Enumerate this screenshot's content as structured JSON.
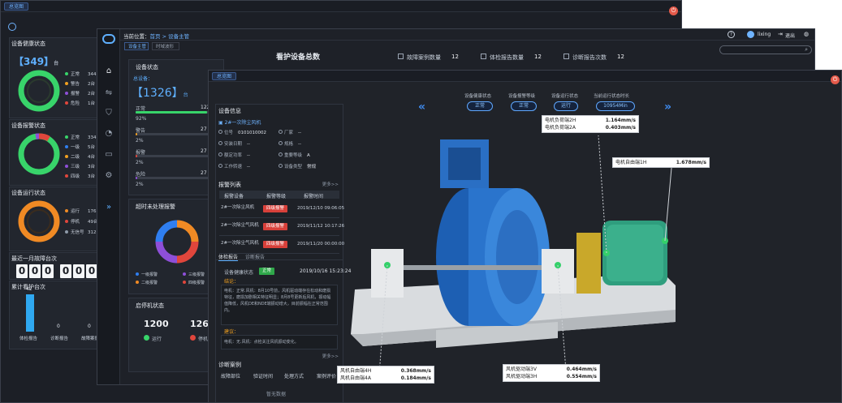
{
  "win1": {
    "tab": "总览图",
    "health_title": "设备健康状态",
    "health_total": "【349】",
    "health_unit": "台",
    "health_legend": [
      {
        "label": "正常",
        "value": "344台",
        "color": "#38d46a"
      },
      {
        "label": "警告",
        "value": "2台",
        "color": "#f0a020"
      },
      {
        "label": "报警",
        "value": "2台",
        "color": "#8e4fd8"
      },
      {
        "label": "危险",
        "value": "1台",
        "color": "#e0463c"
      }
    ],
    "alarm_title": "设备报警状态",
    "alarm_legend": [
      {
        "label": "正常",
        "value": "334台",
        "color": "#38d46a"
      },
      {
        "label": "一级",
        "value": "5台",
        "color": "#2f7ef0"
      },
      {
        "label": "二级",
        "value": "4台",
        "color": "#f0a020"
      },
      {
        "label": "三级",
        "value": "3台",
        "color": "#8e4fd8"
      },
      {
        "label": "四级",
        "value": "3台",
        "color": "#e0463c"
      }
    ],
    "run_title": "设备运行状态",
    "run_legend": [
      {
        "label": "运行",
        "value": "176台",
        "color": "#f08a24"
      },
      {
        "label": "停机",
        "value": "49台",
        "color": "#e0463c"
      },
      {
        "label": "无信号",
        "value": "312台",
        "color": "#8e9aa8"
      }
    ],
    "fault_title": "最近一月故障台次",
    "fault_digits": [
      "0",
      "0",
      "0",
      "0",
      "0",
      "0"
    ],
    "acc_title": "累计看护台次",
    "acc_bars": [
      {
        "label": "体检报告",
        "value": "42",
        "fraction": 1.0
      },
      {
        "label": "诊断报告",
        "value": "0",
        "fraction": 0.0
      },
      {
        "label": "故障案例",
        "value": "0",
        "fraction": 0.0
      }
    ]
  },
  "win2": {
    "breadcrumb_prefix": "当前位置：",
    "breadcrumb": "首页 > 设备主管",
    "tabs": [
      "设备主管",
      "时域波形"
    ],
    "header_title": "看护设备总数",
    "stats": [
      {
        "label": "故障案例数量",
        "value": "12"
      },
      {
        "label": "体检报告数量",
        "value": "12"
      },
      {
        "label": "诊断报告次数",
        "value": "12"
      }
    ],
    "user": "lixing",
    "logout": "退出",
    "status_title": "设备状态",
    "total_label": "总设备：",
    "total_value": "【1326】",
    "total_unit": "台",
    "status_rows": [
      {
        "label": "正常",
        "count": "1220",
        "pct": "92%",
        "color": "#38d46a",
        "fraction": 0.92
      },
      {
        "label": "警告",
        "count": "27",
        "pct": "2%",
        "color": "#f0a020",
        "fraction": 0.02
      },
      {
        "label": "报警",
        "count": "27",
        "pct": "2%",
        "color": "#e0463c",
        "fraction": 0.02
      },
      {
        "label": "危险",
        "count": "27",
        "pct": "2%",
        "color": "#8e4fd8",
        "fraction": 0.02
      }
    ],
    "overdue_title": "超时未处理报警",
    "overdue_legend": [
      "一级报警",
      "三级报警",
      "二级报警",
      "四级报警"
    ],
    "overdue_colors": [
      "#2f7ef0",
      "#8e4fd8",
      "#f08a24",
      "#e0463c"
    ],
    "start_title": "启停机状态",
    "running_value": "1200",
    "running_label": "运行",
    "stop_value": "126",
    "stop_label": "停机"
  },
  "win3": {
    "tab": "总览图",
    "info_title": "设备信息",
    "device_name": "2#一次除尘风机",
    "fields": [
      {
        "label": "位号",
        "value": "0101010002"
      },
      {
        "label": "厂家",
        "value": "--"
      },
      {
        "label": "安装日期",
        "value": "--"
      },
      {
        "label": "规格",
        "value": "--"
      },
      {
        "label": "额定功率",
        "value": "--"
      },
      {
        "label": "重要等级",
        "value": "A"
      },
      {
        "label": "工作转速",
        "value": "--"
      },
      {
        "label": "设备类型",
        "value": "常规"
      }
    ],
    "more": "更多>>",
    "alarm_list_title": "报警列表",
    "alarm_cols": [
      "报警设备",
      "报警等级",
      "报警时间"
    ],
    "alarms": [
      {
        "device": "2#一次除尘风机",
        "level": "四级报警",
        "time": "2019/12/10 09:06:05"
      },
      {
        "device": "2#一次除尘气风机",
        "level": "四级报警",
        "time": "2019/11/12 10:17:26"
      },
      {
        "device": "2#一次除尘气风机",
        "level": "四级报警",
        "time": "2019/11/20 00:00:00"
      }
    ],
    "report_tabs": [
      "体检报告",
      "诊断报告"
    ],
    "health_label": "设备健康状态",
    "health_badge": "正常",
    "report_time": "2019/10/16 15:23:24",
    "conclusion_label": "结论：",
    "conclusion_text": "电机：正常.风机：8月10号前，风机驱动端存在松动和磨损特征，磨损加剧相关特征明显；8月8号更新后风机，振动幅值降低，风机DE和NDE端振动增大，目前振幅在正常范围内。",
    "suggest_label": "建议：",
    "suggest_text": "电机：无.风机：点检关注风机振动变化。",
    "case_title": "诊断案例",
    "case_cols": [
      "故障部位",
      "验证时间",
      "处理方式",
      "案例评价"
    ],
    "empty": "暂无数据",
    "nav_labels": [
      "设备健康状态",
      "设备报警等级",
      "设备运行状态",
      "当前运行状态时长"
    ],
    "nav_values": [
      "正常",
      "正常",
      "运行",
      "10954Min"
    ],
    "callouts": [
      {
        "rows": [
          [
            "电机负荷端2H",
            "1.164mm/s"
          ],
          [
            "电机负荷端2A",
            "0.403mm/s"
          ]
        ]
      },
      {
        "rows": [
          [
            "电机自由端1H",
            "1.678mm/s"
          ]
        ]
      },
      {
        "rows": [
          [
            "风机自由端4H",
            "0.368mm/s"
          ],
          [
            "风机自由端4A",
            "0.184mm/s"
          ]
        ]
      },
      {
        "rows": [
          [
            "风机驱动端3V",
            "0.464mm/s"
          ],
          [
            "风机驱动端3H",
            "0.554mm/s"
          ]
        ]
      }
    ]
  }
}
